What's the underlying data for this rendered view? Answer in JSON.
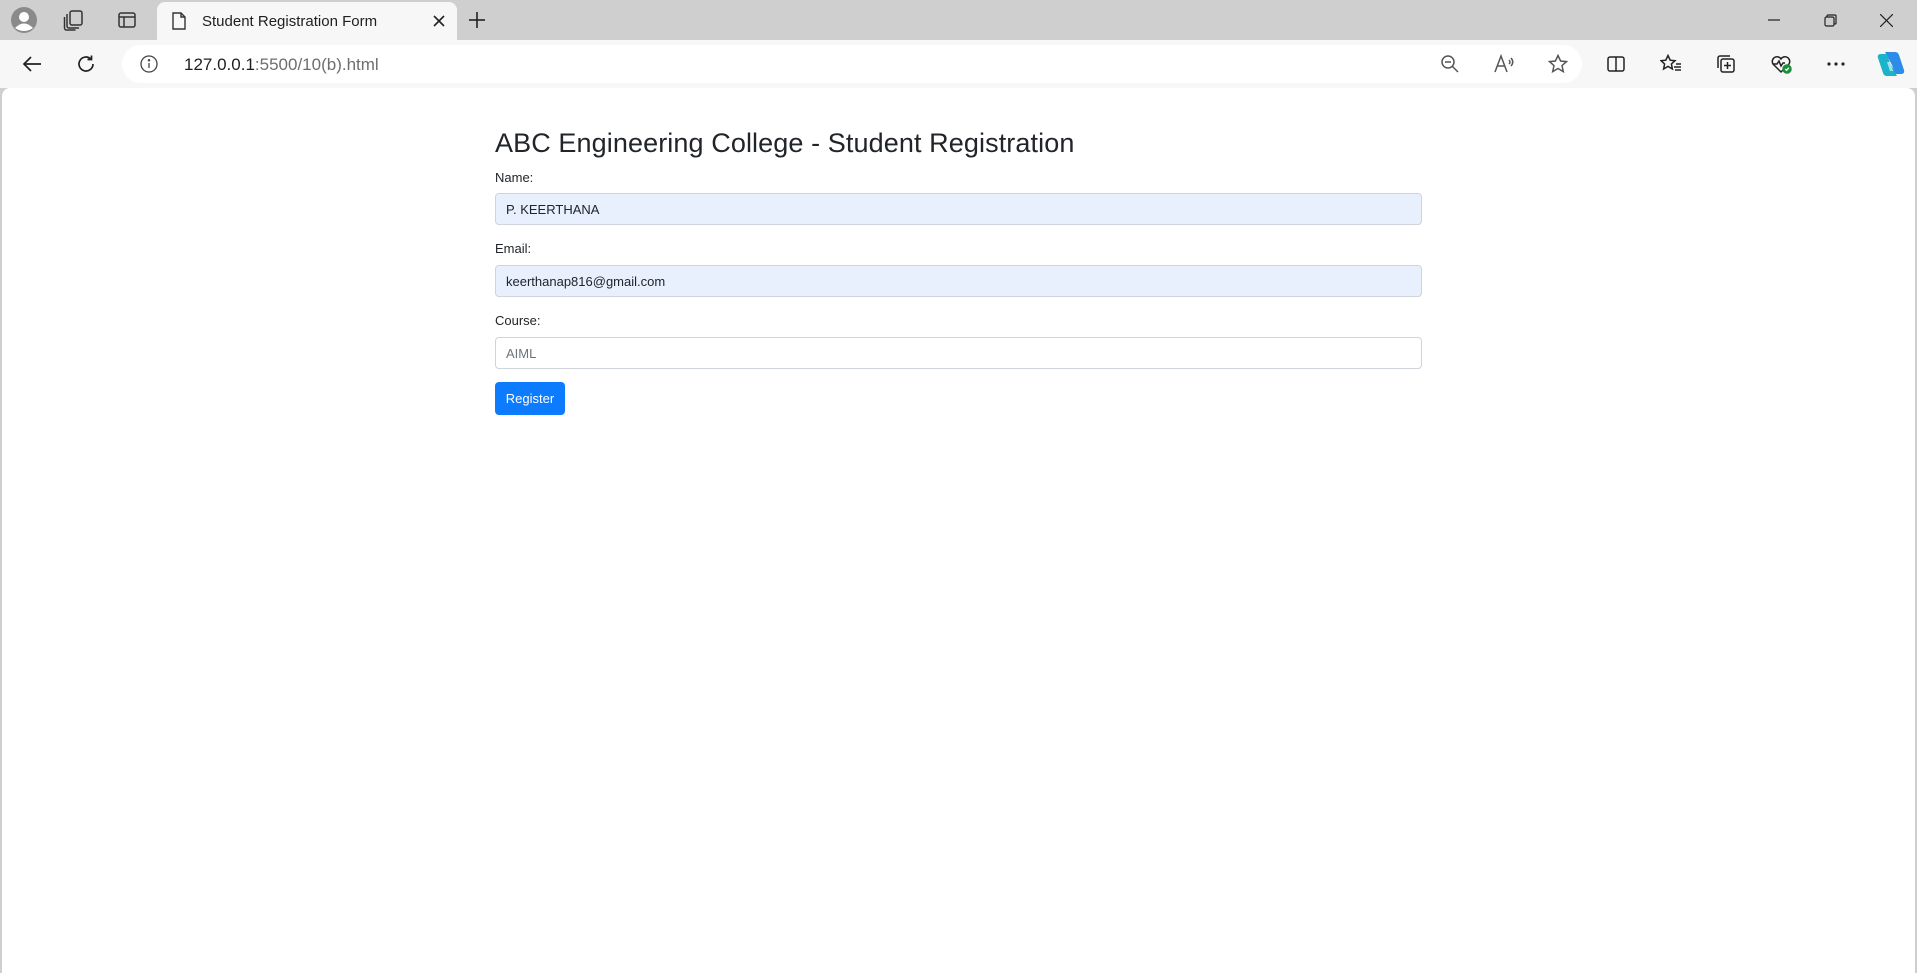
{
  "browser": {
    "tab": {
      "title": "Student Registration Form"
    },
    "url": {
      "host": "127.0.0.1",
      "path": ":5500/10(b).html"
    },
    "accent": "#0d7bfd"
  },
  "page": {
    "title": "ABC Engineering College - Student Registration",
    "form": {
      "name_label": "Name:",
      "name_value": "P. KEERTHANA",
      "email_label": "Email:",
      "email_value": "keerthanap816@gmail.com",
      "course_label": "Course:",
      "course_placeholder": "AIML",
      "register_label": "Register"
    }
  },
  "icons": [
    "profile-icon",
    "workspaces-icon",
    "vertical-tabs-icon",
    "page-icon",
    "close-icon",
    "plus-icon",
    "minimize-icon",
    "restore-icon",
    "window-close-icon",
    "back-arrow-icon",
    "reload-icon",
    "info-icon",
    "zoom-out-icon",
    "read-aloud-icon",
    "star-icon",
    "split-screen-icon",
    "favorites-icon",
    "collections-icon",
    "performance-icon",
    "more-icon",
    "copilot-icon"
  ]
}
